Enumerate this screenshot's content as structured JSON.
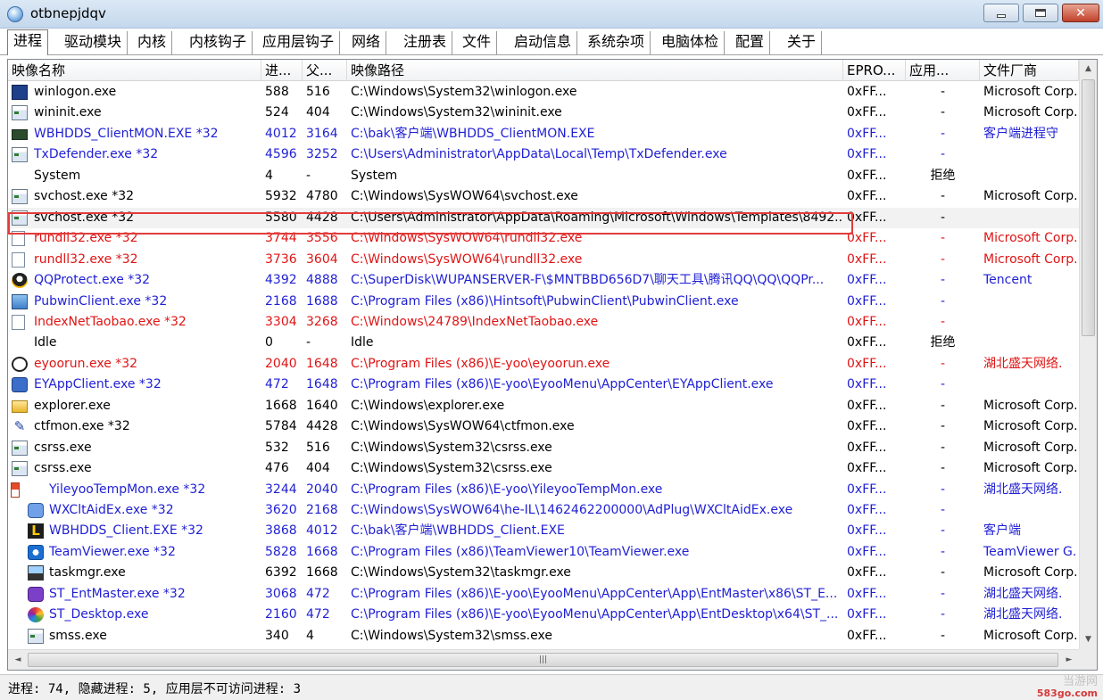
{
  "window": {
    "title": "otbnepjdqv"
  },
  "tabs": [
    {
      "label": "进程",
      "active": true
    },
    {
      "label": "驱动模块"
    },
    {
      "label": "内核"
    },
    {
      "label": "内核钩子"
    },
    {
      "label": "应用层钩子"
    },
    {
      "label": "网络"
    },
    {
      "label": "注册表"
    },
    {
      "label": "文件"
    },
    {
      "label": "启动信息"
    },
    {
      "label": "系统杂项"
    },
    {
      "label": "电脑体检"
    },
    {
      "label": "配置"
    },
    {
      "label": "关于"
    }
  ],
  "columns": [
    "映像名称",
    "进...",
    "父...",
    "映像路径",
    "EPRO...",
    "应用...",
    "文件厂商"
  ],
  "colors": {
    "normal": "#000000",
    "blue": "#1f1fd4",
    "red": "#e01414",
    "selection_border": "#e33b3b"
  },
  "rows": [
    {
      "icon": "winlogon-icon",
      "name": "winlogon.exe",
      "pid": "588",
      "ppid": "516",
      "path": "C:\\Windows\\System32\\winlogon.exe",
      "eprocess": "0xFF...",
      "access": "-",
      "vendor": "Microsoft Corp.",
      "color": "normal",
      "indent": false
    },
    {
      "icon": "app-window-icon",
      "name": "wininit.exe",
      "pid": "524",
      "ppid": "404",
      "path": "C:\\Windows\\System32\\wininit.exe",
      "eprocess": "0xFF...",
      "access": "-",
      "vendor": "Microsoft Corp.",
      "color": "normal",
      "indent": false
    },
    {
      "icon": "monitor-app-icon",
      "name": "WBHDDS_ClientMON.EXE *32",
      "pid": "4012",
      "ppid": "3164",
      "path": "C:\\bak\\客户端\\WBHDDS_ClientMON.EXE",
      "eprocess": "0xFF...",
      "access": "-",
      "vendor": "客户端进程守",
      "color": "blue",
      "indent": false
    },
    {
      "icon": "app-window-icon",
      "name": "TxDefender.exe *32",
      "pid": "4596",
      "ppid": "3252",
      "path": "C:\\Users\\Administrator\\AppData\\Local\\Temp\\TxDefender.exe",
      "eprocess": "0xFF...",
      "access": "-",
      "vendor": "",
      "color": "blue",
      "indent": false
    },
    {
      "icon": "",
      "name": "System",
      "pid": "4",
      "ppid": "-",
      "path": "System",
      "eprocess": "0xFF...",
      "access": "拒绝",
      "vendor": "",
      "color": "normal",
      "indent": false
    },
    {
      "icon": "app-window-icon",
      "name": "svchost.exe *32",
      "pid": "5932",
      "ppid": "4780",
      "path": "C:\\Windows\\SysWOW64\\svchost.exe",
      "eprocess": "0xFF...",
      "access": "-",
      "vendor": "Microsoft Corp.",
      "color": "normal",
      "indent": false
    },
    {
      "icon": "app-window-icon",
      "name": "svchost.exe *32",
      "pid": "5580",
      "ppid": "4428",
      "path": "C:\\Users\\Administrator\\AppData\\Roaming\\Microsoft\\Windows\\Templates\\8492...",
      "eprocess": "0xFF...",
      "access": "-",
      "vendor": "",
      "color": "normal",
      "indent": false,
      "selected": true
    },
    {
      "icon": "document-icon",
      "name": "rundll32.exe *32",
      "pid": "3744",
      "ppid": "3556",
      "path": "C:\\Windows\\SysWOW64\\rundll32.exe",
      "eprocess": "0xFF...",
      "access": "-",
      "vendor": "Microsoft Corp.",
      "color": "red",
      "indent": false
    },
    {
      "icon": "document-icon",
      "name": "rundll32.exe *32",
      "pid": "3736",
      "ppid": "3604",
      "path": "C:\\Windows\\SysWOW64\\rundll32.exe",
      "eprocess": "0xFF...",
      "access": "-",
      "vendor": "Microsoft Corp.",
      "color": "red",
      "indent": false
    },
    {
      "icon": "qq-penguin-icon",
      "name": "QQProtect.exe *32",
      "pid": "4392",
      "ppid": "4888",
      "path": "C:\\SuperDisk\\WUPANSERVER-F\\$MNTBBD656D7\\聊天工具\\腾讯QQ\\QQ\\QQPr...",
      "eprocess": "0xFF...",
      "access": "-",
      "vendor": "Tencent",
      "color": "blue",
      "indent": false
    },
    {
      "icon": "computer-icon",
      "name": "PubwinClient.exe *32",
      "pid": "2168",
      "ppid": "1688",
      "path": "C:\\Program Files (x86)\\Hintsoft\\PubwinClient\\PubwinClient.exe",
      "eprocess": "0xFF...",
      "access": "-",
      "vendor": "",
      "color": "blue",
      "indent": false
    },
    {
      "icon": "document-icon",
      "name": "IndexNetTaobao.exe *32",
      "pid": "3304",
      "ppid": "3268",
      "path": "C:\\Windows\\24789\\IndexNetTaobao.exe",
      "eprocess": "0xFF...",
      "access": "-",
      "vendor": "",
      "color": "red",
      "indent": false
    },
    {
      "icon": "",
      "name": "Idle",
      "pid": "0",
      "ppid": "-",
      "path": "Idle",
      "eprocess": "0xFF...",
      "access": "拒绝",
      "vendor": "",
      "color": "normal",
      "indent": false
    },
    {
      "icon": "power-circle-icon",
      "name": "eyoorun.exe *32",
      "pid": "2040",
      "ppid": "1648",
      "path": "C:\\Program Files (x86)\\E-yoo\\eyoorun.exe",
      "eprocess": "0xFF...",
      "access": "-",
      "vendor": "湖北盛天网络.",
      "color": "red",
      "indent": false
    },
    {
      "icon": "user-icon",
      "name": "EYAppClient.exe *32",
      "pid": "472",
      "ppid": "1648",
      "path": "C:\\Program Files (x86)\\E-yoo\\EyooMenu\\AppCenter\\EYAppClient.exe",
      "eprocess": "0xFF...",
      "access": "-",
      "vendor": "",
      "color": "blue",
      "indent": false
    },
    {
      "icon": "folder-icon",
      "name": "explorer.exe",
      "pid": "1668",
      "ppid": "1640",
      "path": "C:\\Windows\\explorer.exe",
      "eprocess": "0xFF...",
      "access": "-",
      "vendor": "Microsoft Corp.",
      "color": "normal",
      "indent": false
    },
    {
      "icon": "pen-icon",
      "name": "ctfmon.exe *32",
      "pid": "5784",
      "ppid": "4428",
      "path": "C:\\Windows\\SysWOW64\\ctfmon.exe",
      "eprocess": "0xFF...",
      "access": "-",
      "vendor": "Microsoft Corp.",
      "color": "normal",
      "indent": false
    },
    {
      "icon": "app-window-icon",
      "name": "csrss.exe",
      "pid": "532",
      "ppid": "516",
      "path": "C:\\Windows\\System32\\csrss.exe",
      "eprocess": "0xFF...",
      "access": "-",
      "vendor": "Microsoft Corp.",
      "color": "normal",
      "indent": false
    },
    {
      "icon": "app-window-icon",
      "name": "csrss.exe",
      "pid": "476",
      "ppid": "404",
      "path": "C:\\Windows\\System32\\csrss.exe",
      "eprocess": "0xFF...",
      "access": "-",
      "vendor": "Microsoft Corp.",
      "color": "normal",
      "indent": false
    },
    {
      "icon": "torch-icon",
      "name": "YileyooTempMon.exe *32",
      "pid": "3244",
      "ppid": "2040",
      "path": "C:\\Program Files (x86)\\E-yoo\\YileyooTempMon.exe",
      "eprocess": "0xFF...",
      "access": "-",
      "vendor": "湖北盛天网络.",
      "color": "blue",
      "indent": true
    },
    {
      "icon": "people-icon",
      "name": "WXCltAidEx.exe *32",
      "pid": "3620",
      "ppid": "2168",
      "path": "C:\\Windows\\SysWOW64\\he-IL\\1462462200000\\AdPlug\\WXCltAidEx.exe",
      "eprocess": "0xFF...",
      "access": "-",
      "vendor": "",
      "color": "blue",
      "indent": true
    },
    {
      "icon": "l-logo-icon",
      "name": "WBHDDS_Client.EXE *32",
      "pid": "3868",
      "ppid": "4012",
      "path": "C:\\bak\\客户端\\WBHDDS_Client.EXE",
      "eprocess": "0xFF...",
      "access": "-",
      "vendor": "客户端",
      "color": "blue",
      "indent": true
    },
    {
      "icon": "teamviewer-icon",
      "name": "TeamViewer.exe *32",
      "pid": "5828",
      "ppid": "1668",
      "path": "C:\\Program Files (x86)\\TeamViewer10\\TeamViewer.exe",
      "eprocess": "0xFF...",
      "access": "-",
      "vendor": "TeamViewer G.",
      "color": "blue",
      "indent": true
    },
    {
      "icon": "taskmgr-icon",
      "name": "taskmgr.exe",
      "pid": "6392",
      "ppid": "1668",
      "path": "C:\\Windows\\System32\\taskmgr.exe",
      "eprocess": "0xFF...",
      "access": "-",
      "vendor": "Microsoft Corp.",
      "color": "normal",
      "indent": true
    },
    {
      "icon": "purple-app-icon",
      "name": "ST_EntMaster.exe *32",
      "pid": "3068",
      "ppid": "472",
      "path": "C:\\Program Files (x86)\\E-yoo\\EyooMenu\\AppCenter\\App\\EntMaster\\x86\\ST_E...",
      "eprocess": "0xFF...",
      "access": "-",
      "vendor": "湖北盛天网络.",
      "color": "blue",
      "indent": true
    },
    {
      "icon": "colorful-ball-icon",
      "name": "ST_Desktop.exe",
      "pid": "2160",
      "ppid": "472",
      "path": "C:\\Program Files (x86)\\E-yoo\\EyooMenu\\AppCenter\\App\\EntDesktop\\x64\\ST_...",
      "eprocess": "0xFF...",
      "access": "-",
      "vendor": "湖北盛天网络.",
      "color": "blue",
      "indent": true
    },
    {
      "icon": "app-window-icon",
      "name": "smss.exe",
      "pid": "340",
      "ppid": "4",
      "path": "C:\\Windows\\System32\\smss.exe",
      "eprocess": "0xFF...",
      "access": "-",
      "vendor": "Microsoft Corp.",
      "color": "normal",
      "indent": true
    }
  ],
  "status": {
    "text": "进程: 74, 隐藏进程: 5, 应用层不可访问进程: 3"
  },
  "watermark": {
    "name": "当游网",
    "url": "583go.com"
  }
}
